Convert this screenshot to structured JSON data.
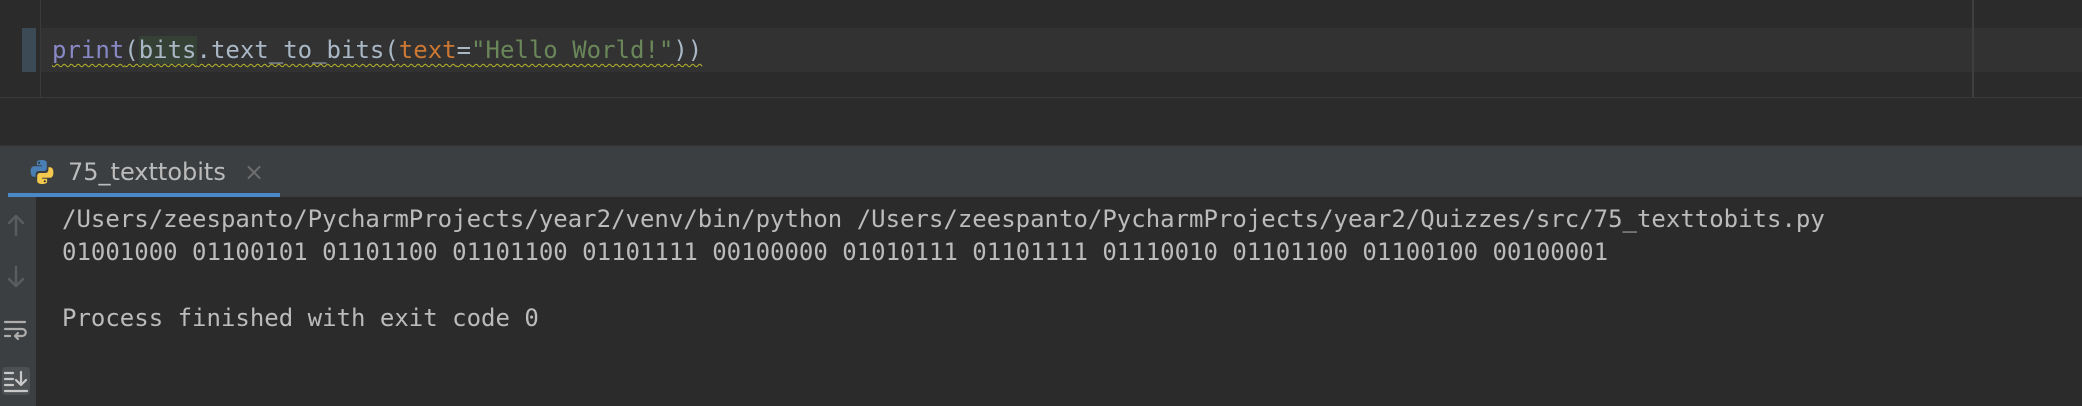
{
  "editor": {
    "code": {
      "fn": "print",
      "open_paren": "(",
      "module": "bits",
      "dot_method": ".text_to_bits(",
      "param": "text",
      "equals": "=",
      "string": "\"Hello World!\"",
      "close_parens": "))"
    }
  },
  "run_panel": {
    "tab_label": "75_texttobits",
    "close_glyph": "×",
    "icons": {
      "tab": "python-icon",
      "close": "close-icon",
      "toolbar": [
        "arrow-up-icon",
        "arrow-down-icon",
        "soft-wrap-icon",
        "scroll-to-end-icon"
      ]
    },
    "console_lines": [
      "/Users/zeespanto/PycharmProjects/year2/venv/bin/python /Users/zeespanto/PycharmProjects/year2/Quizzes/src/75_texttobits.py",
      "01001000 01100101 01101100 01101100 01101111 00100000 01010111 01101111 01110010 01101100 01100100 00100001",
      "",
      "Process finished with exit code 0"
    ]
  },
  "colors": {
    "editor_bg": "#2b2b2b",
    "panel_bg": "#3c3f41",
    "accent": "#4a88c7",
    "keyword": "#cc7832",
    "string": "#6a8759",
    "builtin": "#8888c6",
    "text": "#a9b7c6",
    "console_text": "#bbbbbb"
  }
}
